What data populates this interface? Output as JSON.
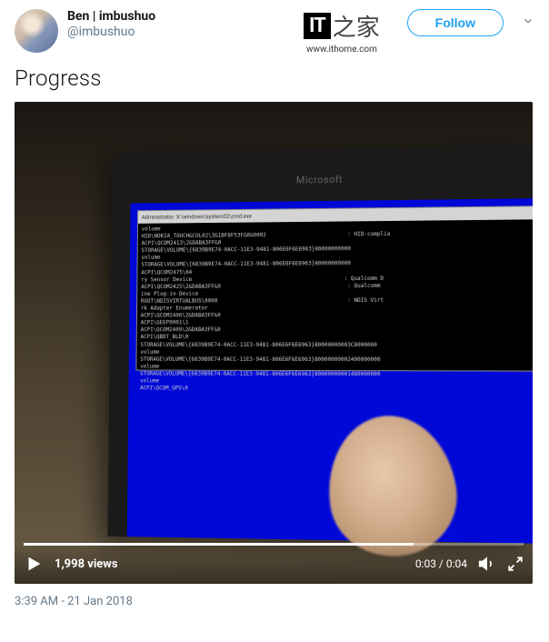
{
  "user": {
    "display_name": "Ben | imbushuo",
    "handle": "@imbushuo"
  },
  "buttons": {
    "follow": "Follow"
  },
  "watermark": {
    "logo_text": "IT",
    "home_char": "之家",
    "url": "www.ithome.com"
  },
  "tweet": {
    "text": "Progress",
    "timestamp": "3:39 AM - 21 Jan 2018"
  },
  "video": {
    "views": "1,998 views",
    "current_time": "0:03",
    "duration": "0:04",
    "phone_brand": "Microsoft",
    "terminal_title": "Administrator: X:\\windows\\system32\\cmd.exe",
    "terminal_lines": [
      "volume",
      "HID\\NOKIA_TOUCH&COL02\\3&1BF8F53F&0&0002                         : HID-complia",
      "ACPI\\QCOM2413\\2&DABA3FF&0",
      "STORAGE\\VOLUME\\{6839B9E74-0ACC-11E3-9481-806E6F6E6963}80000000000",
      "volume",
      "STORAGE\\VOLUME\\{6839B9E74-0ACC-11E3-9481-806E6F6E6963}80000000000",
      "ACPI\\QCOM2475\\64",
      "ry Sensor Device                                               : Qualcomm D",
      "ACPI\\QCOM2425\\2&DABA3FF&0                                       : Qualcomm ",
      "ine Plug-in Device",
      "ROOT\\NDISVIRTUALBUS\\0000                                        : NDIS Virt",
      "rk Adapter Enumerator",
      "ACPI\\QCOM2406\\2&DABA3FF&0",
      "ACPI\\GEEP0001\\1",
      "ACPI\\QCOM2409\\2&DABA3FF&0",
      "ACPI\\QBDT_BLD\\0",
      "STORAGE\\VOLUME\\{6839B9E74-0ACC-11E3-9481-806E6F6E6963}80000000003C8000000",
      "volume",
      "STORAGE\\VOLUME\\{6839B9E74-0ACC-11E3-9481-806E6F6E6963}80000000002400000000",
      "volume",
      "STORAGE\\VOLUME\\{6839B9E74-0ACC-11E3-9481-806E6F6E6963}80000000001480000000",
      "volume",
      "ACPI\\QCOM_GPS\\0"
    ]
  }
}
